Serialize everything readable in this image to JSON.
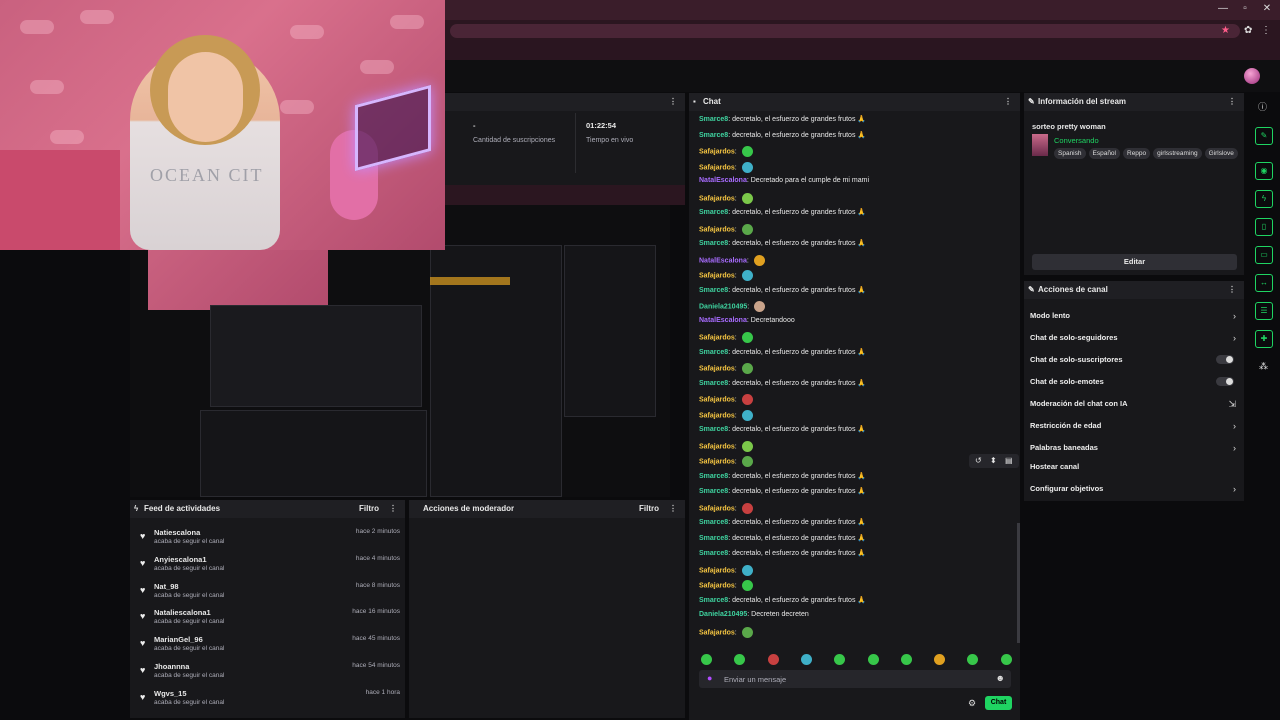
{
  "stats": {
    "subs_value": "-",
    "subs_label": "Cantidad de suscripciones",
    "time_value": "01:22:54",
    "time_label": "Tiempo en vivo"
  },
  "chat": {
    "title": "Chat",
    "input_placeholder": "Enviar un mensaje",
    "send_label": "Chat",
    "messages": [
      {
        "user": "Smarce8",
        "text": "decretalo, el esfuerzo de grandes frutos 🙏",
        "cls": "u-g"
      },
      {
        "user": "Smarce8",
        "text": "decretalo, el esfuerzo de grandes frutos 🙏",
        "cls": "u-g"
      },
      {
        "user": "Safajardos",
        "text": "",
        "cls": "u-y",
        "emote": "#37c74a"
      },
      {
        "user": "Safajardos",
        "text": "",
        "cls": "u-y",
        "emote": "#3fb0c8"
      },
      {
        "user": "NatalEscalona",
        "text": "Decretado para el cumple de mi mami",
        "cls": "u-p"
      },
      {
        "user": "Safajardos",
        "text": "",
        "cls": "u-y",
        "emote": "#7bc84a"
      },
      {
        "user": "Smarce8",
        "text": "decretalo, el esfuerzo de grandes frutos 🙏",
        "cls": "u-g"
      },
      {
        "user": "Safajardos",
        "text": "",
        "cls": "u-y",
        "emote": "#5aa84a"
      },
      {
        "user": "Smarce8",
        "text": "decretalo, el esfuerzo de grandes frutos 🙏",
        "cls": "u-g"
      },
      {
        "user": "NatalEscalona",
        "text": "",
        "cls": "u-p",
        "emote": "#e0a020"
      },
      {
        "user": "Safajardos",
        "text": "",
        "cls": "u-y",
        "emote": "#3fb0c8"
      },
      {
        "user": "Smarce8",
        "text": "decretalo, el esfuerzo de grandes frutos 🙏",
        "cls": "u-g"
      },
      {
        "user": "Daniela210495",
        "text": "",
        "cls": "u-g",
        "emote": "#c9a38a"
      },
      {
        "user": "NatalEscalona",
        "text": "Decretandooo",
        "cls": "u-p"
      },
      {
        "user": "Safajardos",
        "text": "",
        "cls": "u-y",
        "emote": "#37c74a"
      },
      {
        "user": "Smarce8",
        "text": "decretalo, el esfuerzo de grandes frutos 🙏",
        "cls": "u-g"
      },
      {
        "user": "Safajardos",
        "text": "",
        "cls": "u-y",
        "emote": "#5aa84a"
      },
      {
        "user": "Smarce8",
        "text": "decretalo, el esfuerzo de grandes frutos 🙏",
        "cls": "u-g"
      },
      {
        "user": "Safajardos",
        "text": "",
        "cls": "u-y",
        "emote": "#c84040"
      },
      {
        "user": "Safajardos",
        "text": "",
        "cls": "u-y",
        "emote": "#3fb0c8"
      },
      {
        "user": "Smarce8",
        "text": "decretalo, el esfuerzo de grandes frutos 🙏",
        "cls": "u-g"
      },
      {
        "user": "Safajardos",
        "text": "",
        "cls": "u-y",
        "emote": "#7bc84a"
      },
      {
        "user": "Safajardos",
        "text": "",
        "cls": "u-y",
        "emote": "#5aa84a"
      },
      {
        "user": "Smarce8",
        "text": "decretalo, el esfuerzo de grandes frutos 🙏",
        "cls": "u-g"
      },
      {
        "user": "Smarce8",
        "text": "decretalo, el esfuerzo de grandes frutos 🙏",
        "cls": "u-g"
      },
      {
        "user": "Safajardos",
        "text": "",
        "cls": "u-y",
        "emote": "#c84040"
      },
      {
        "user": "Smarce8",
        "text": "decretalo, el esfuerzo de grandes frutos 🙏",
        "cls": "u-g"
      },
      {
        "user": "Smarce8",
        "text": "decretalo, el esfuerzo de grandes frutos 🙏",
        "cls": "u-g"
      },
      {
        "user": "Smarce8",
        "text": "decretalo, el esfuerzo de grandes frutos 🙏",
        "cls": "u-g"
      },
      {
        "user": "Safajardos",
        "text": "",
        "cls": "u-y",
        "emote": "#3fb0c8"
      },
      {
        "user": "Safajardos",
        "text": "",
        "cls": "u-y",
        "emote": "#37c74a"
      },
      {
        "user": "Smarce8",
        "text": "decretalo, el esfuerzo de grandes frutos 🙏",
        "cls": "u-g"
      },
      {
        "user": "Daniela210495",
        "text": "Decreten decreten",
        "cls": "u-g"
      },
      {
        "user": "Safajardos",
        "text": "",
        "cls": "u-y",
        "emote": "#5aa84a"
      }
    ],
    "emote_bar": [
      "#37c74a",
      "#37c74a",
      "#c84040",
      "#3fb0c8",
      "#37c74a",
      "#37c74a",
      "#37c74a",
      "#e0a020",
      "#37c74a",
      "#37c74a"
    ]
  },
  "stream_info": {
    "title": "Información del stream",
    "stream_title": "sorteo pretty woman",
    "category": "Conversando",
    "tags": [
      "Spanish",
      "Español",
      "Reppo",
      "girlsstreaming",
      "Girlslove"
    ],
    "edit_label": "Editar"
  },
  "channel_actions": {
    "title": "Acciones de canal",
    "items": [
      {
        "label": "Modo lento",
        "control": "chevron"
      },
      {
        "label": "Chat de solo-seguidores",
        "control": "chevron"
      },
      {
        "label": "Chat de solo-suscriptores",
        "control": "toggle"
      },
      {
        "label": "Chat de solo-emotes",
        "control": "toggle"
      },
      {
        "label": "Moderación del chat con IA",
        "control": "ext"
      },
      {
        "label": "Restricción de edad",
        "control": "chevron"
      },
      {
        "label": "Palabras baneadas",
        "control": "chevron"
      },
      {
        "label": "Hostear canal",
        "control": "none"
      },
      {
        "label": "Configurar objetivos",
        "control": "chevron"
      }
    ]
  },
  "activity_feed": {
    "title": "Feed de actividades",
    "filter_label": "Filtro",
    "items": [
      {
        "name": "Natiescalona",
        "sub": "acaba de seguir el canal",
        "time": "hace 2 minutos"
      },
      {
        "name": "Anyiescalona1",
        "sub": "acaba de seguir el canal",
        "time": "hace 4 minutos"
      },
      {
        "name": "Nat_98",
        "sub": "acaba de seguir el canal",
        "time": "hace 8 minutos"
      },
      {
        "name": "Nataliescalona1",
        "sub": "acaba de seguir el canal",
        "time": "hace 16 minutos"
      },
      {
        "name": "MarianGel_96",
        "sub": "acaba de seguir el canal",
        "time": "hace 45 minutos"
      },
      {
        "name": "Jhoannna",
        "sub": "acaba de seguir el canal",
        "time": "hace 54 minutos"
      },
      {
        "name": "Wgvs_15",
        "sub": "acaba de seguir el canal",
        "time": "hace 1 hora"
      }
    ]
  },
  "mod_actions": {
    "title": "Acciones de moderador",
    "filter_label": "Filtro"
  },
  "webcam": {
    "shirt_text": "OCEAN CIT"
  },
  "colors": {
    "accent": "#1fd462",
    "chrome": "#3a1d2a"
  }
}
